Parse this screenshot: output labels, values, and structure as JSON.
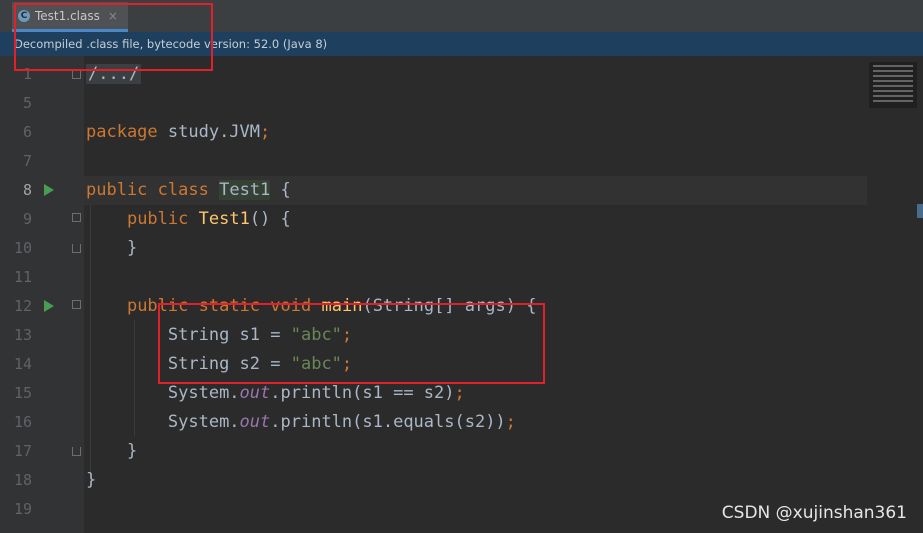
{
  "tab": {
    "icon": "class-file-icon",
    "icon_glyph": "C",
    "label": "Test1.class",
    "close": "×"
  },
  "info_bar": {
    "text": "Decompiled .class file, bytecode version: 52.0 (Java 8)"
  },
  "code": {
    "fold": "/.../",
    "package_kw": "package",
    "package_name": " study.JVM",
    "semi": ";",
    "public": "public",
    "class_kw": "class",
    "class_name": "Test1",
    "open_brace": " {",
    "ctor_name": "Test1",
    "ctor_tail": "() {",
    "close_brace": "}",
    "static": "static",
    "void": "void",
    "main": "main",
    "main_tail": "(String[] args) {",
    "string_type": "String",
    "s1_decl": " s1 = ",
    "s2_decl": " s2 = ",
    "abc": "\"abc\"",
    "system": "System.",
    "out": "out",
    "println1": ".println(s1 == s2)",
    "println2": ".println(s1.equals(s2))"
  },
  "line_numbers": [
    "1",
    "5",
    "6",
    "7",
    "8",
    "9",
    "10",
    "11",
    "12",
    "13",
    "14",
    "15",
    "16",
    "17",
    "18",
    "19"
  ],
  "watermark": "CSDN @xujinshan361",
  "colors": {
    "keyword": "#cc7832",
    "string": "#6a8759",
    "method": "#ffc66d",
    "field": "#9876aa",
    "annotation_box": "#e0202a"
  }
}
